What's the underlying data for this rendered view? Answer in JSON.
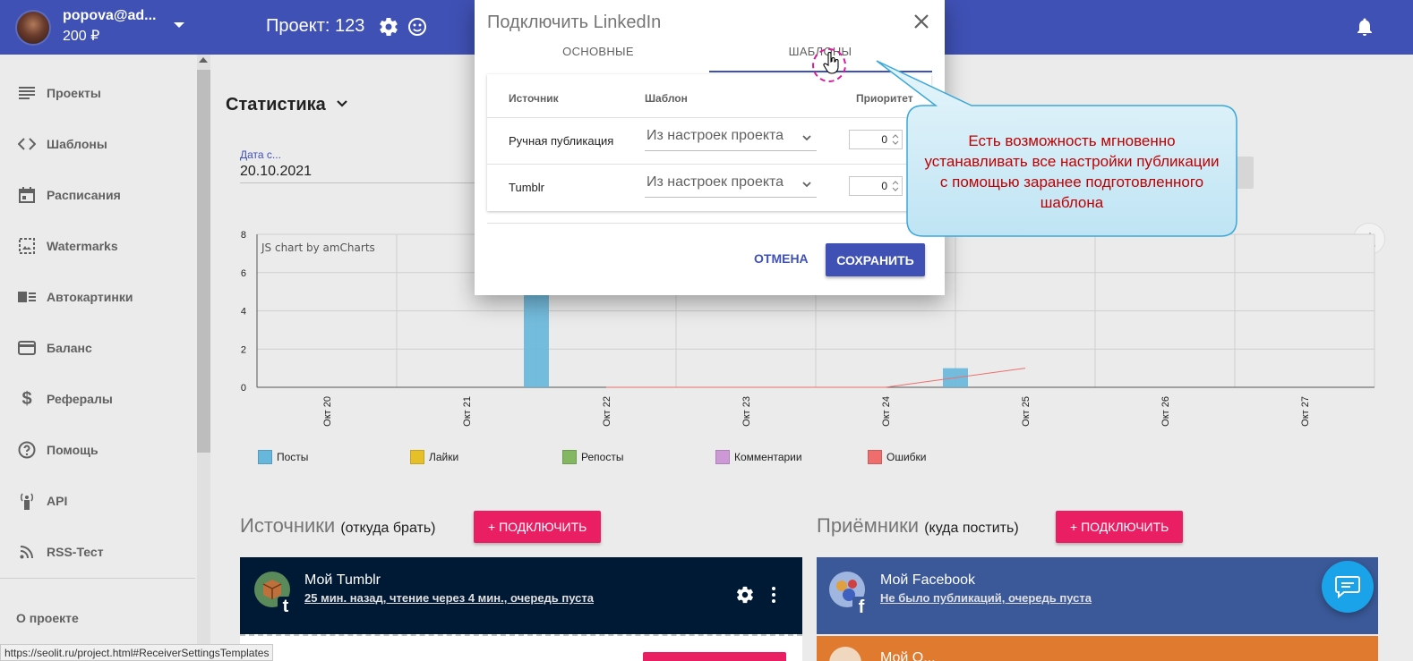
{
  "topbar": {
    "user_email": "popova@ad...",
    "user_balance": "200 ₽",
    "project_label": "Проект: 123"
  },
  "sidebar": {
    "items": [
      {
        "label": "Проекты",
        "icon": "list-icon"
      },
      {
        "label": "Шаблоны",
        "icon": "code-icon"
      },
      {
        "label": "Расписания",
        "icon": "calendar-icon"
      },
      {
        "label": "Watermarks",
        "icon": "image-icon"
      },
      {
        "label": "Автокартинки",
        "icon": "auto-image-icon"
      },
      {
        "label": "Баланс",
        "icon": "credit-card-icon"
      },
      {
        "label": "Рефералы",
        "icon": "dollar-icon"
      },
      {
        "label": "Помощь",
        "icon": "help-icon"
      },
      {
        "label": "API",
        "icon": "antenna-icon"
      },
      {
        "label": "RSS-Тест",
        "icon": "rss-icon"
      }
    ],
    "about": "О проекте"
  },
  "stats": {
    "title": "Статистика",
    "date_label": "Дата с...",
    "date_value": "20.10.2021"
  },
  "chart_data": {
    "type": "bar",
    "watermark": "JS chart by amCharts",
    "categories": [
      "Окт 20",
      "Окт 21",
      "Окт 22",
      "Окт 23",
      "Окт 24",
      "Окт 25",
      "Окт 26",
      "Окт 27"
    ],
    "ylim": [
      0,
      8
    ],
    "yticks": [
      0,
      2,
      4,
      6,
      8
    ],
    "series": [
      {
        "name": "Посты",
        "color": "#67b7dc",
        "values": [
          0,
          5,
          0,
          0,
          1,
          0,
          0,
          0
        ]
      },
      {
        "name": "Лайки",
        "color": "#e5c029",
        "values": [
          0,
          0,
          0,
          0,
          0,
          0,
          0,
          0
        ]
      },
      {
        "name": "Репосты",
        "color": "#84b761",
        "values": [
          0,
          0,
          0,
          0,
          0,
          0,
          0,
          0
        ]
      },
      {
        "name": "Комментарии",
        "color": "#cc99d6",
        "values": [
          0,
          0,
          0,
          0,
          0,
          0,
          0,
          0
        ]
      },
      {
        "name": "Ошибки",
        "color": "#ef6d6d",
        "values": [
          0,
          0,
          0,
          0,
          0,
          1,
          0,
          0
        ]
      }
    ],
    "grid": true
  },
  "sources": {
    "title": "Источники",
    "subtitle": "(откуда брать)",
    "connect": "+ ПОДКЛЮЧИТЬ",
    "card": {
      "title": "Мой Tumblr",
      "sub": "25 мин. назад, чтение через 4 мин., очередь пуста",
      "color": "#001935"
    }
  },
  "receivers": {
    "title": "Приёмники",
    "subtitle": "(куда постить)",
    "connect": "+ ПОДКЛЮЧИТЬ",
    "card": {
      "title": "Мой Facebook",
      "sub": "Не было публикаций, очередь пуста",
      "color": "#3b5998"
    },
    "card2": {
      "title": "Мой О...",
      "color": "#e07a2e"
    }
  },
  "status_url": "https://seolit.ru/project.html#ReceiverSettingsTemplates",
  "dialog": {
    "title": "Подключить LinkedIn",
    "tabs": [
      "ОСНОВНЫЕ",
      "ШАБЛОНЫ"
    ],
    "columns": [
      "Источник",
      "Шаблон",
      "Приоритет"
    ],
    "rows": [
      {
        "source": "Ручная публикация",
        "template": "Из настроек проекта",
        "priority": "0"
      },
      {
        "source": "Tumblr",
        "template": "Из настроек проекта",
        "priority": "0"
      }
    ],
    "cancel": "ОТМЕНА",
    "save": "СОХРАНИТЬ"
  },
  "callout": {
    "text": "Есть возможность мгновенно устанавливать все настройки публикации с помощью заранее подготовленного шаблона"
  }
}
